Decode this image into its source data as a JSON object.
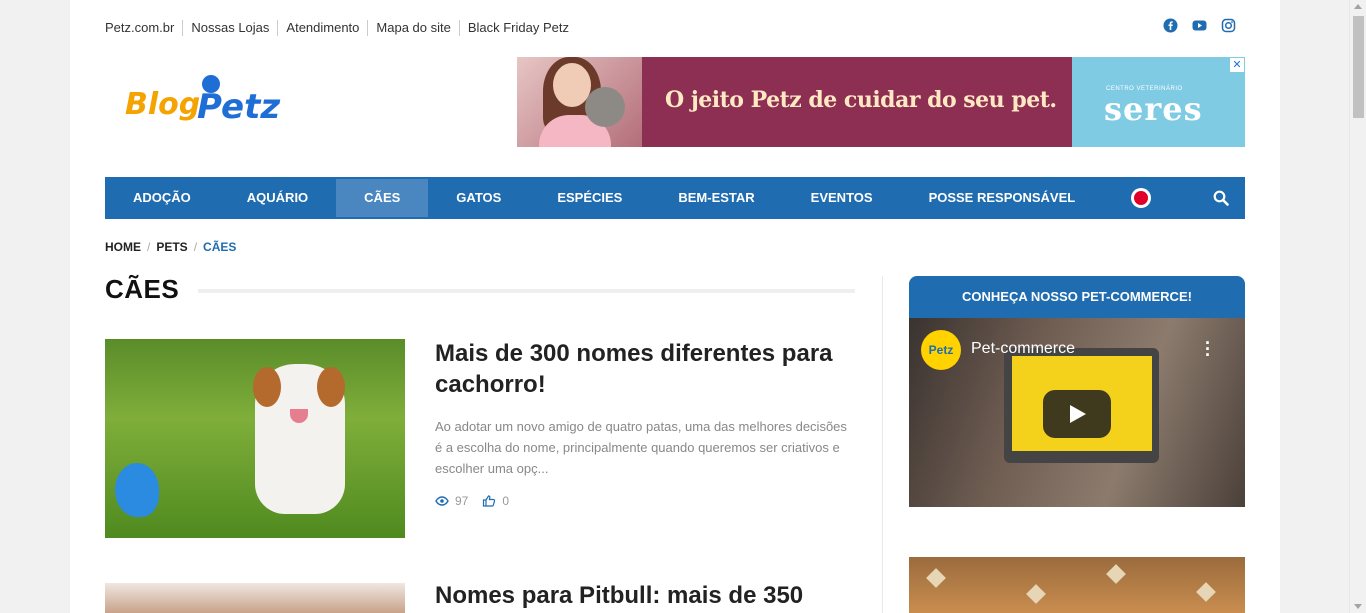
{
  "top_links": [
    "Petz.com.br",
    "Nossas Lojas",
    "Atendimento",
    "Mapa do site",
    "Black Friday Petz"
  ],
  "social_icons": [
    "facebook-icon",
    "youtube-icon",
    "instagram-icon"
  ],
  "logo": {
    "text": "BlogPetz"
  },
  "banner": {
    "headline": "O jeito Petz  de cuidar do seu pet.",
    "brand_small": "CENTRO VETERINÁRIO",
    "brand": "seres",
    "close": "✕"
  },
  "nav": {
    "items": [
      "ADOÇÃO",
      "AQUÁRIO",
      "CÃES",
      "GATOS",
      "ESPÉCIES",
      "BEM-ESTAR",
      "EVENTOS",
      "POSSE RESPONSÁVEL"
    ],
    "active": "CÃES"
  },
  "breadcrumb": {
    "home": "HOME",
    "pets": "PETS",
    "current": "CÃES",
    "sep": "/"
  },
  "category_title": "CÃES",
  "posts": [
    {
      "title": "Mais de 300 nomes diferentes para cachorro!",
      "excerpt": "Ao adotar um novo amigo de quatro patas, uma das melhores decisões é a escolha do nome, principalmente quando queremos ser criativos e escolher uma opç...",
      "views": "97",
      "likes": "0"
    },
    {
      "title": "Nomes para Pitbull: mais de 350"
    }
  ],
  "sidebar": {
    "widget_title": "CONHEÇA NOSSO PET-COMMERCE!",
    "video_title": "Pet-commerce",
    "channel_logo": "Petz"
  },
  "colors": {
    "nav": "#1f6cb0",
    "nav_active": "#4a87c0",
    "banner": "#8c2f52",
    "seres": "#7ecbe3"
  }
}
